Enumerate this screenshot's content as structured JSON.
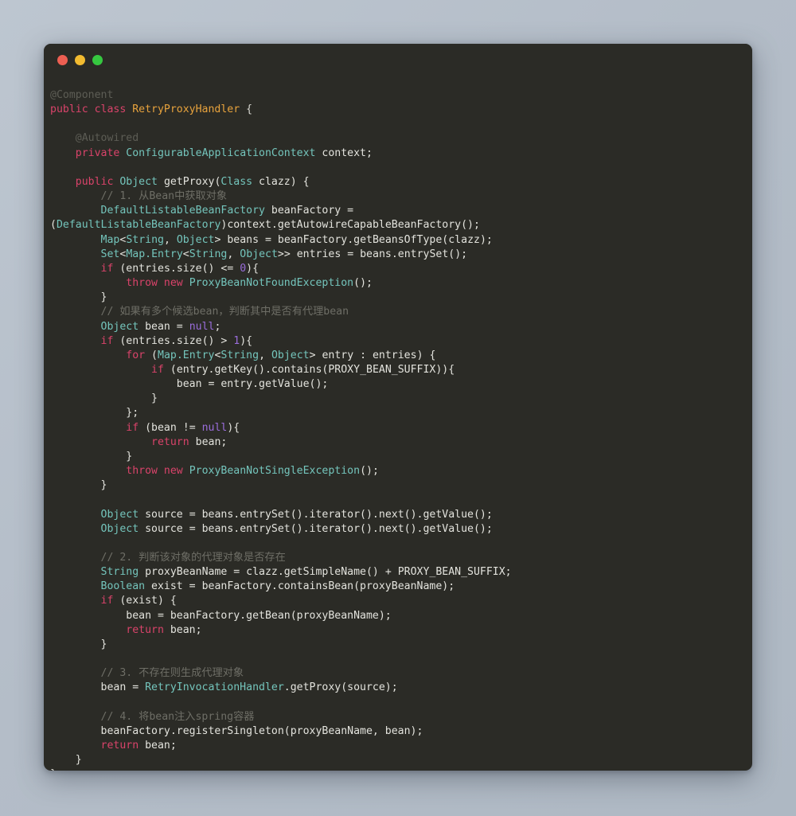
{
  "window": {
    "traffic_lights": [
      {
        "name": "close-button",
        "color": "#ed5f52",
        "label": "Close"
      },
      {
        "name": "minimize-button",
        "color": "#f2bb30",
        "label": "Minimize"
      },
      {
        "name": "maximize-button",
        "color": "#36c840",
        "label": "Maximize"
      }
    ],
    "background": "#2b2b26",
    "page_background": "#b4bdc8"
  },
  "editor": {
    "language": "java",
    "theme_colors": {
      "keyword": "#d9436a",
      "type": "#74c5bc",
      "class_name": "#e8a33d",
      "comment": "#6e6e66",
      "annotation": "#5d5d55",
      "number": "#9a6ddb",
      "text": "#d8d8d2"
    },
    "lines": [
      "@Component",
      "public class RetryProxyHandler {",
      "",
      "    @Autowired",
      "    private ConfigurableApplicationContext context;",
      "",
      "    public Object getProxy(Class clazz) {",
      "        // 1. 从Bean中获取对象",
      "        DefaultListableBeanFactory beanFactory =",
      "(DefaultListableBeanFactory)context.getAutowireCapableBeanFactory();",
      "        Map<String, Object> beans = beanFactory.getBeansOfType(clazz);",
      "        Set<Map.Entry<String, Object>> entries = beans.entrySet();",
      "        if (entries.size() <= 0){",
      "            throw new ProxyBeanNotFoundException();",
      "        }",
      "        // 如果有多个候选bean，判断其中是否有代理bean",
      "        Object bean = null;",
      "        if (entries.size() > 1){",
      "            for (Map.Entry<String, Object> entry : entries) {",
      "                if (entry.getKey().contains(PROXY_BEAN_SUFFIX)){",
      "                    bean = entry.getValue();",
      "                }",
      "            };",
      "            if (bean != null){",
      "                return bean;",
      "            }",
      "            throw new ProxyBeanNotSingleException();",
      "        }",
      "",
      "        Object source = beans.entrySet().iterator().next().getValue();",
      "        Object source = beans.entrySet().iterator().next().getValue();",
      "",
      "        // 2. 判断该对象的代理对象是否存在",
      "        String proxyBeanName = clazz.getSimpleName() + PROXY_BEAN_SUFFIX;",
      "        Boolean exist = beanFactory.containsBean(proxyBeanName);",
      "        if (exist) {",
      "            bean = beanFactory.getBean(proxyBeanName);",
      "            return bean;",
      "        }",
      "",
      "        // 3. 不存在则生成代理对象",
      "        bean = RetryInvocationHandler.getProxy(source);",
      "",
      "        // 4. 将bean注入spring容器",
      "        beanFactory.registerSingleton(proxyBeanName, bean);",
      "        return bean;",
      "    }",
      "}"
    ],
    "tokens": [
      [
        [
          "@Component",
          "ann"
        ]
      ],
      [
        [
          "public class ",
          "kw"
        ],
        [
          "RetryProxyHandler",
          "cls"
        ],
        [
          " {",
          "pun"
        ]
      ],
      [],
      [
        [
          "    @Autowired",
          "ann"
        ]
      ],
      [
        [
          "    ",
          "pun"
        ],
        [
          "private",
          "kw"
        ],
        [
          " ",
          "pun"
        ],
        [
          "ConfigurableApplicationContext",
          "typ"
        ],
        [
          " context;",
          "id"
        ]
      ],
      [],
      [
        [
          "    ",
          "pun"
        ],
        [
          "public",
          "kw"
        ],
        [
          " ",
          "pun"
        ],
        [
          "Object",
          "typ"
        ],
        [
          " getProxy(",
          "id"
        ],
        [
          "Class",
          "typ"
        ],
        [
          " clazz) {",
          "id"
        ]
      ],
      [
        [
          "        // 1. 从Bean中获取对象",
          "cmt"
        ]
      ],
      [
        [
          "        ",
          "pun"
        ],
        [
          "DefaultListableBeanFactory",
          "typ"
        ],
        [
          " beanFactory =",
          "id"
        ]
      ],
      [
        [
          "(",
          "id"
        ],
        [
          "DefaultListableBeanFactory",
          "typ"
        ],
        [
          ")context.getAutowireCapableBeanFactory();",
          "id"
        ]
      ],
      [
        [
          "        ",
          "pun"
        ],
        [
          "Map",
          "typ"
        ],
        [
          "<",
          "id"
        ],
        [
          "String",
          "typ"
        ],
        [
          ", ",
          "id"
        ],
        [
          "Object",
          "typ"
        ],
        [
          "> beans = beanFactory.getBeansOfType(clazz);",
          "id"
        ]
      ],
      [
        [
          "        ",
          "pun"
        ],
        [
          "Set",
          "typ"
        ],
        [
          "<",
          "id"
        ],
        [
          "Map.Entry",
          "typ"
        ],
        [
          "<",
          "id"
        ],
        [
          "String",
          "typ"
        ],
        [
          ", ",
          "id"
        ],
        [
          "Object",
          "typ"
        ],
        [
          ">> entries = beans.entrySet();",
          "id"
        ]
      ],
      [
        [
          "        ",
          "pun"
        ],
        [
          "if",
          "kw"
        ],
        [
          " (entries.size() <= ",
          "id"
        ],
        [
          "0",
          "num"
        ],
        [
          "){",
          "id"
        ]
      ],
      [
        [
          "            ",
          "pun"
        ],
        [
          "throw new ",
          "kw"
        ],
        [
          "ProxyBeanNotFoundException",
          "typ"
        ],
        [
          "();",
          "id"
        ]
      ],
      [
        [
          "        }",
          "id"
        ]
      ],
      [
        [
          "        // 如果有多个候选bean，判断其中是否有代理bean",
          "cmt"
        ]
      ],
      [
        [
          "        ",
          "pun"
        ],
        [
          "Object",
          "typ"
        ],
        [
          " bean = ",
          "id"
        ],
        [
          "null",
          "num"
        ],
        [
          ";",
          "id"
        ]
      ],
      [
        [
          "        ",
          "pun"
        ],
        [
          "if",
          "kw"
        ],
        [
          " (entries.size() > ",
          "id"
        ],
        [
          "1",
          "num"
        ],
        [
          "){",
          "id"
        ]
      ],
      [
        [
          "            ",
          "pun"
        ],
        [
          "for",
          "kw"
        ],
        [
          " (",
          "id"
        ],
        [
          "Map.Entry",
          "typ"
        ],
        [
          "<",
          "id"
        ],
        [
          "String",
          "typ"
        ],
        [
          ", ",
          "id"
        ],
        [
          "Object",
          "typ"
        ],
        [
          "> entry : entries) {",
          "id"
        ]
      ],
      [
        [
          "                ",
          "pun"
        ],
        [
          "if",
          "kw"
        ],
        [
          " (entry.getKey().contains(PROXY_BEAN_SUFFIX)){",
          "id"
        ]
      ],
      [
        [
          "                    bean = entry.getValue();",
          "id"
        ]
      ],
      [
        [
          "                }",
          "id"
        ]
      ],
      [
        [
          "            };",
          "id"
        ]
      ],
      [
        [
          "            ",
          "pun"
        ],
        [
          "if",
          "kw"
        ],
        [
          " (bean != ",
          "id"
        ],
        [
          "null",
          "num"
        ],
        [
          "){",
          "id"
        ]
      ],
      [
        [
          "                ",
          "pun"
        ],
        [
          "return",
          "kw"
        ],
        [
          " bean;",
          "id"
        ]
      ],
      [
        [
          "            }",
          "id"
        ]
      ],
      [
        [
          "            ",
          "pun"
        ],
        [
          "throw new ",
          "kw"
        ],
        [
          "ProxyBeanNotSingleException",
          "typ"
        ],
        [
          "();",
          "id"
        ]
      ],
      [
        [
          "        }",
          "id"
        ]
      ],
      [],
      [
        [
          "        ",
          "pun"
        ],
        [
          "Object",
          "typ"
        ],
        [
          " source = beans.entrySet().iterator().next().getValue();",
          "id"
        ]
      ],
      [
        [
          "        ",
          "pun"
        ],
        [
          "Object",
          "typ"
        ],
        [
          " source = beans.entrySet().iterator().next().getValue();",
          "id"
        ]
      ],
      [],
      [
        [
          "        // 2. 判断该对象的代理对象是否存在",
          "cmt"
        ]
      ],
      [
        [
          "        ",
          "pun"
        ],
        [
          "String",
          "typ"
        ],
        [
          " proxyBeanName = clazz.getSimpleName() + PROXY_BEAN_SUFFIX;",
          "id"
        ]
      ],
      [
        [
          "        ",
          "pun"
        ],
        [
          "Boolean",
          "typ"
        ],
        [
          " exist = beanFactory.containsBean(proxyBeanName);",
          "id"
        ]
      ],
      [
        [
          "        ",
          "pun"
        ],
        [
          "if",
          "kw"
        ],
        [
          " (exist) {",
          "id"
        ]
      ],
      [
        [
          "            bean = beanFactory.getBean(proxyBeanName);",
          "id"
        ]
      ],
      [
        [
          "            ",
          "pun"
        ],
        [
          "return",
          "kw"
        ],
        [
          " bean;",
          "id"
        ]
      ],
      [
        [
          "        }",
          "id"
        ]
      ],
      [],
      [
        [
          "        // 3. 不存在则生成代理对象",
          "cmt"
        ]
      ],
      [
        [
          "        bean = ",
          "id"
        ],
        [
          "RetryInvocationHandler",
          "typ"
        ],
        [
          ".getProxy(source);",
          "id"
        ]
      ],
      [],
      [
        [
          "        // 4. 将bean注入spring容器",
          "cmt"
        ]
      ],
      [
        [
          "        beanFactory.registerSingleton(proxyBeanName, bean);",
          "id"
        ]
      ],
      [
        [
          "        ",
          "pun"
        ],
        [
          "return",
          "kw"
        ],
        [
          " bean;",
          "id"
        ]
      ],
      [
        [
          "    }",
          "id"
        ]
      ],
      [
        [
          "}",
          "id"
        ]
      ]
    ]
  }
}
